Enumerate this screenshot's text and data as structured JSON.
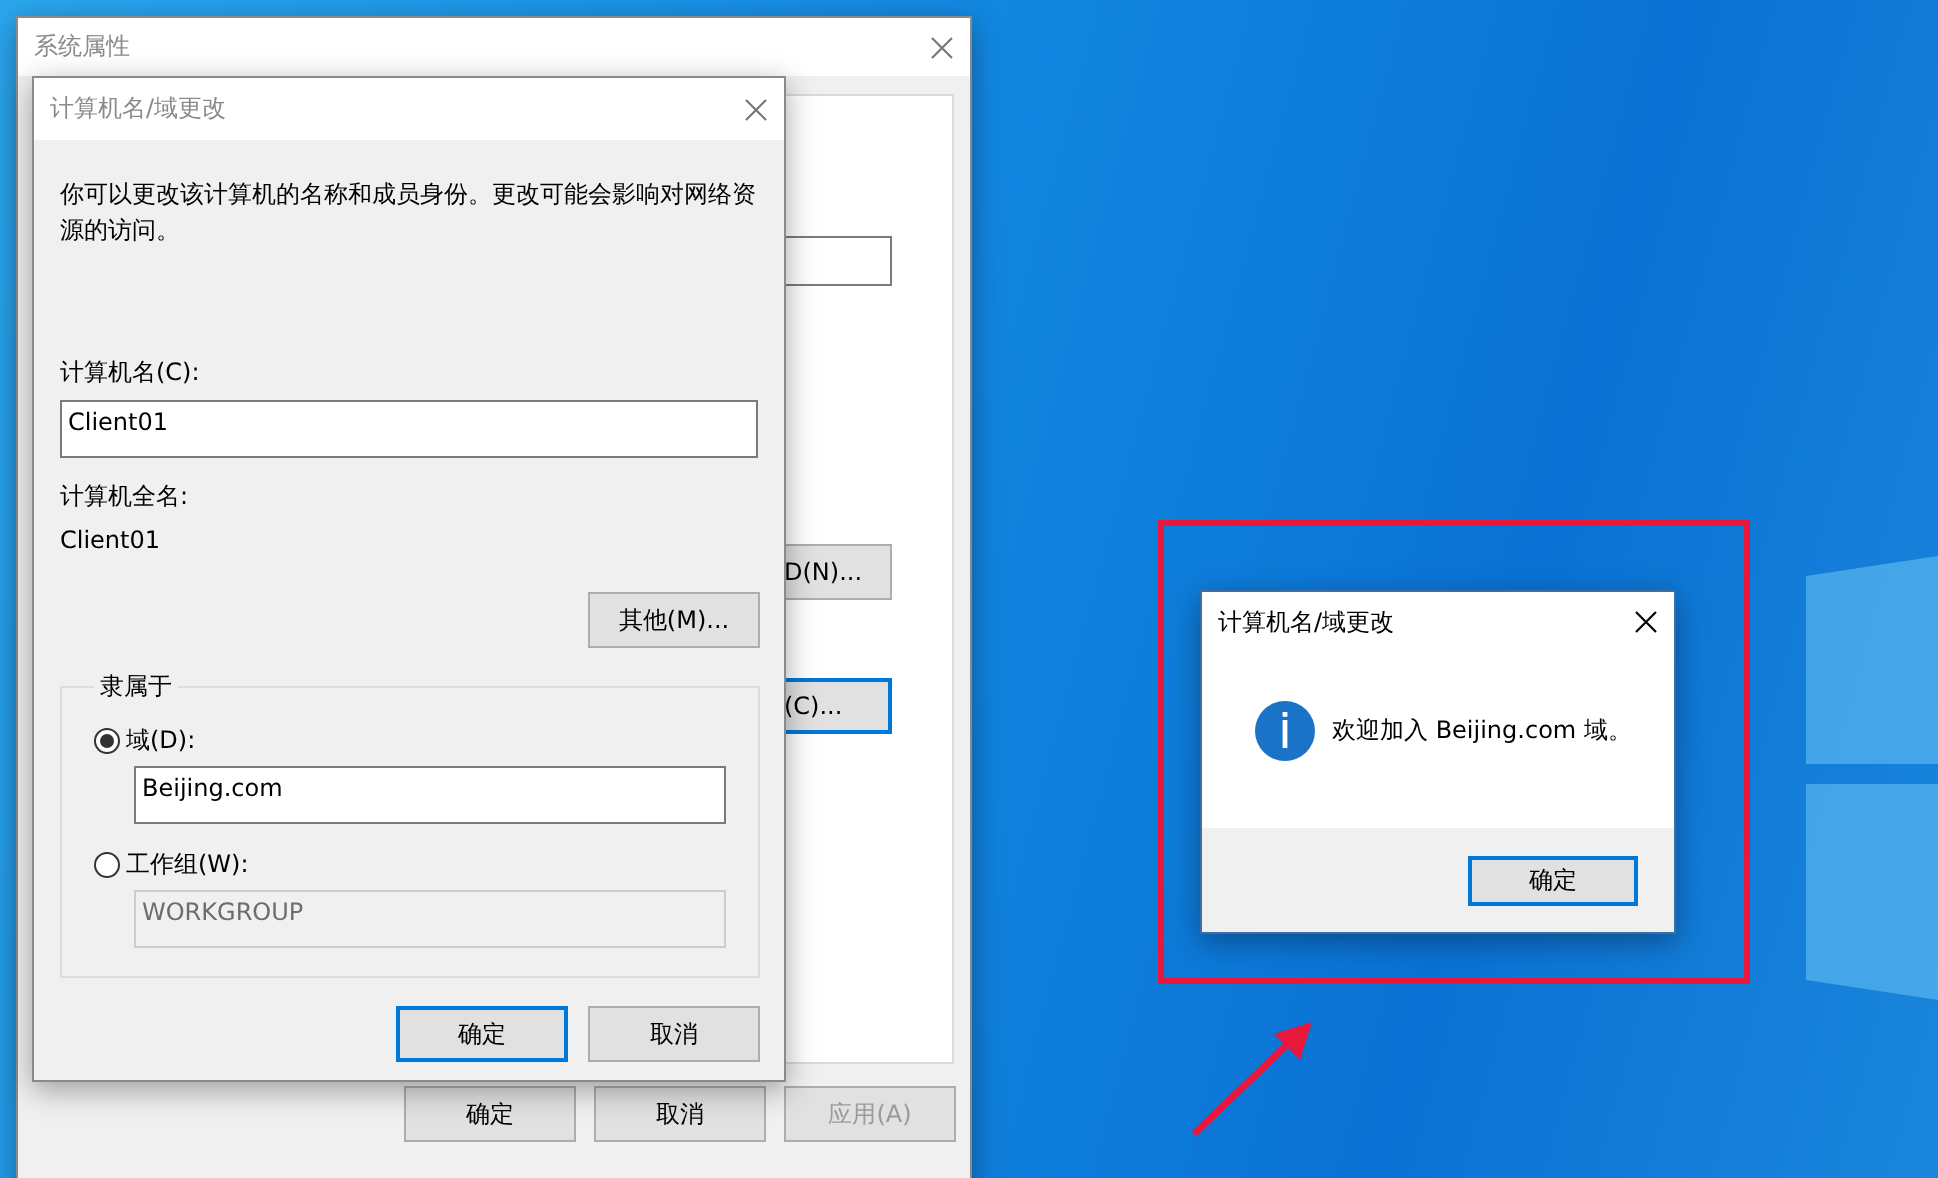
{
  "background_window": {
    "title": "系统属性",
    "active": false,
    "visible_controls": [
      {
        "kind": "field"
      },
      {
        "kind": "button",
        "label": "D(N)...",
        "default": false
      },
      {
        "kind": "button",
        "label": "(C)...",
        "default": true
      }
    ],
    "buttons": [
      {
        "label": "确定",
        "disabled": false
      },
      {
        "label": "取消",
        "disabled": false
      },
      {
        "label": "应用(A)",
        "disabled": true
      }
    ]
  },
  "dialog": {
    "title": "计算机名/域更改",
    "active": false,
    "description": "你可以更改该计算机的名称和成员身份。更改可能会影响对网络资源的访问。",
    "computer_name_label": "计算机名(C):",
    "computer_name_value": "Client01",
    "full_name_label": "计算机全名:",
    "full_name": "Client01",
    "more_button": "其他(M)...",
    "member_of": {
      "legend": "隶属于",
      "options": [
        {
          "label": "域(D):",
          "selected": true,
          "value": "Beijing.com",
          "disabled": false
        },
        {
          "label": "工作组(W):",
          "selected": false,
          "value": "WORKGROUP",
          "disabled": true
        }
      ]
    },
    "buttons": [
      {
        "label": "确定",
        "default": true
      },
      {
        "label": "取消",
        "default": false
      }
    ]
  },
  "message_box": {
    "title": "计算机名/域更改",
    "active": true,
    "message": "欢迎加入 Beijing.com 域。",
    "buttons": [
      {
        "label": "确定",
        "default": true
      }
    ]
  }
}
